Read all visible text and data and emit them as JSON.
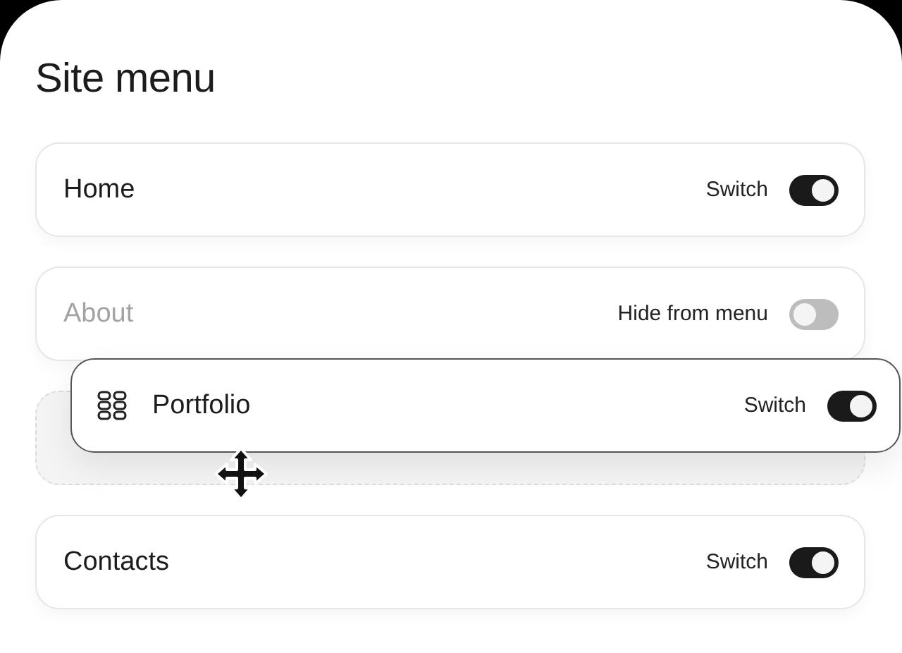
{
  "title": "Site menu",
  "items": [
    {
      "label": "Home",
      "switch_label": "Switch",
      "on": true,
      "dragging": false
    },
    {
      "label": "About",
      "switch_label": "Hide from menu",
      "on": false,
      "dragging": false
    },
    {
      "label": "Portfolio",
      "switch_label": "Switch",
      "on": true,
      "dragging": true
    },
    {
      "label": "Contacts",
      "switch_label": "Switch",
      "on": true,
      "dragging": false
    }
  ]
}
